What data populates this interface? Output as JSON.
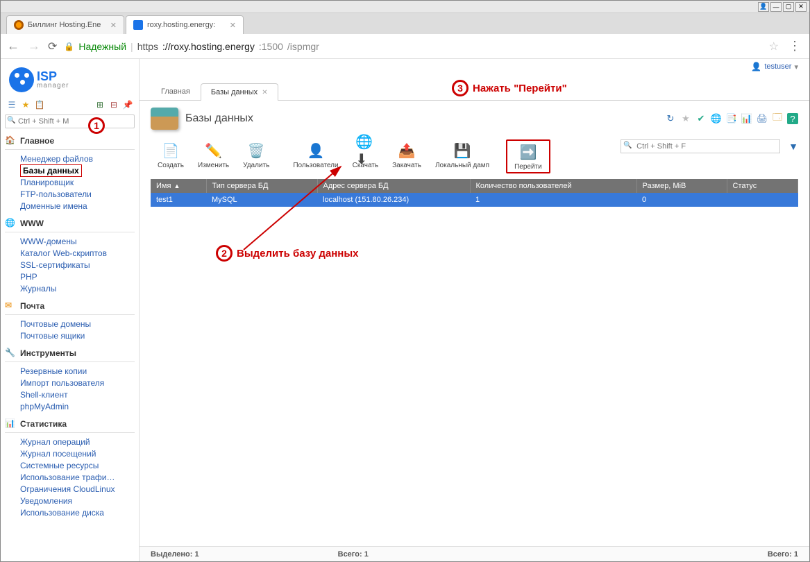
{
  "window": {
    "title": "roxy.hosting.energy"
  },
  "browser": {
    "tabs": [
      {
        "label": "Биллинг Hosting.Ene",
        "active": false
      },
      {
        "label": "roxy.hosting.energy:",
        "active": true
      }
    ],
    "secure_label": "Надежный",
    "url_scheme": "https",
    "url_host": "://roxy.hosting.energy",
    "url_port": ":1500",
    "url_path": "/ispmgr"
  },
  "logo": {
    "top": "ISP",
    "bottom": "manager"
  },
  "user": {
    "name": "testuser"
  },
  "sidebar": {
    "search_placeholder": "Ctrl + Shift + M",
    "sections": [
      {
        "title": "Главное",
        "icon": "🏠",
        "color": "#d9534f",
        "items": [
          "Менеджер файлов",
          "Базы данных",
          "Планировщик",
          "FTP-пользователи",
          "Доменные имена"
        ],
        "active_index": 1
      },
      {
        "title": "WWW",
        "icon": "🌐",
        "color": "#2a8",
        "items": [
          "WWW-домены",
          "Каталог Web-скриптов",
          "SSL-сертификаты",
          "PHP",
          "Журналы"
        ]
      },
      {
        "title": "Почта",
        "icon": "✉",
        "color": "#f0ad4e",
        "items": [
          "Почтовые домены",
          "Почтовые ящики"
        ]
      },
      {
        "title": "Инструменты",
        "icon": "🔧",
        "color": "#d9534f",
        "items": [
          "Резервные копии",
          "Импорт пользователя",
          "Shell-клиент",
          "phpMyAdmin"
        ]
      },
      {
        "title": "Статистика",
        "icon": "📊",
        "color": "#5bc0de",
        "items": [
          "Журнал операций",
          "Журнал посещений",
          "Системные ресурсы",
          "Использование трафи…",
          "Ограничения CloudLinux",
          "Уведомления",
          "Использование диска"
        ]
      }
    ]
  },
  "app_tabs": [
    {
      "label": "Главная",
      "active": false,
      "closable": false
    },
    {
      "label": "Базы данных",
      "active": true,
      "closable": true
    }
  ],
  "page": {
    "title": "Базы данных"
  },
  "toolbar": {
    "buttons": [
      {
        "label": "Создать",
        "icon": "📄"
      },
      {
        "label": "Изменить",
        "icon": "✏️"
      },
      {
        "label": "Удалить",
        "icon": "🗑️"
      },
      {
        "label": "Пользователи",
        "icon": "👤"
      },
      {
        "label": "Скачать",
        "icon": "🌐⬇"
      },
      {
        "label": "Закачать",
        "icon": "📤"
      },
      {
        "label": "Локальный дамп",
        "icon": "💾"
      },
      {
        "label": "Перейти",
        "icon": "➡️"
      }
    ],
    "highlight_index": 7,
    "search_placeholder": "Ctrl + Shift + F"
  },
  "table": {
    "columns": [
      "Имя",
      "Тип сервера БД",
      "Адрес сервера БД",
      "Количество пользователей",
      "Размер, MiB",
      "Статус"
    ],
    "sort_column": 0,
    "rows": [
      {
        "cells": [
          "test1",
          "MySQL",
          "localhost (151.80.26.234)",
          "1",
          "0",
          ""
        ],
        "selected": true
      }
    ]
  },
  "status": {
    "selected_label": "Выделено:",
    "selected_count": "1",
    "total_label": "Всего:",
    "total_count": "1",
    "total_label2": "Всего:",
    "total_count2": "1"
  },
  "annotations": {
    "a1": "1",
    "a2": "2",
    "a2_text": "Выделить базу данных",
    "a3": "3",
    "a3_text": "Нажать \"Перейти\""
  }
}
